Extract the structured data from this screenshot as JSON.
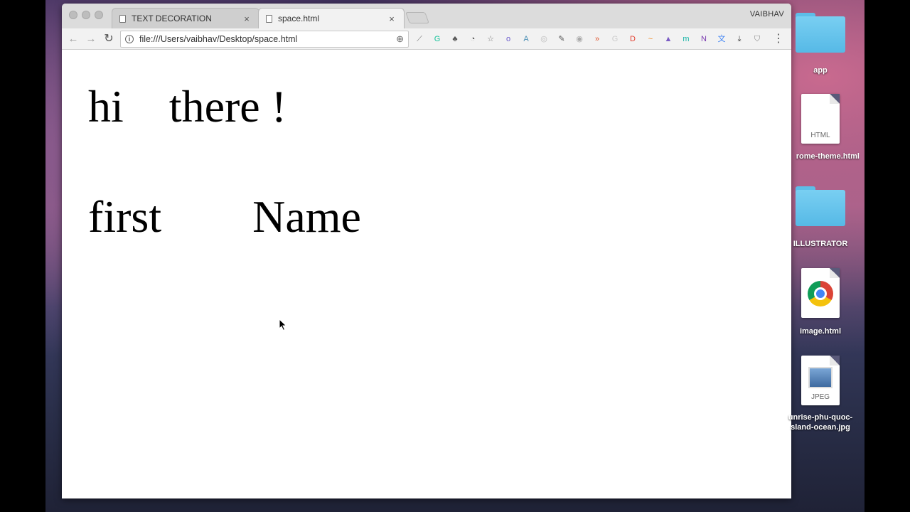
{
  "browser": {
    "tabs": [
      {
        "title": "TEXT DECORATION",
        "close": "×"
      },
      {
        "title": "space.html",
        "close": "×"
      }
    ],
    "profile_name": "VAIBHAV",
    "url": "file:///Users/vaibhav/Desktop/space.html",
    "nav": {
      "back": "←",
      "forward": "→",
      "reload": "↻"
    },
    "info_glyph": "i",
    "zoom_glyph": "⊕",
    "menu_glyph": "⋮",
    "extensions": [
      {
        "name": "extension-1-icon",
        "glyph": "⟋",
        "color": "#777777"
      },
      {
        "name": "grammarly-icon",
        "glyph": "G",
        "color": "#15c39a"
      },
      {
        "name": "evernote-icon",
        "glyph": "♣",
        "color": "#555555"
      },
      {
        "name": "speed-icon",
        "glyph": "◔",
        "color": "#555555"
      },
      {
        "name": "bookmark-star-icon",
        "glyph": "☆",
        "color": "#777777"
      },
      {
        "name": "extension-o-icon",
        "glyph": "o",
        "color": "#6a5acd"
      },
      {
        "name": "extension-a-icon",
        "glyph": "A",
        "color": "#4a8fb5"
      },
      {
        "name": "camera-icon",
        "glyph": "◎",
        "color": "#bbbbbb"
      },
      {
        "name": "eyedropper-icon",
        "glyph": "✎",
        "color": "#555555"
      },
      {
        "name": "extension-circle-icon",
        "glyph": "◉",
        "color": "#aaaaaa"
      },
      {
        "name": "arrow-forward-icon",
        "glyph": "»",
        "color": "#e0552e"
      },
      {
        "name": "extension-g-icon",
        "glyph": "G",
        "color": "#cccccc"
      },
      {
        "name": "extension-d-icon",
        "glyph": "D",
        "color": "#e33e2e"
      },
      {
        "name": "extension-wave-icon",
        "glyph": "~",
        "color": "#f08a24"
      },
      {
        "name": "chart-icon",
        "glyph": "▲",
        "color": "#7b5cc4"
      },
      {
        "name": "extension-m-icon",
        "glyph": "m",
        "color": "#17b5a7"
      },
      {
        "name": "onenote-icon",
        "glyph": "N",
        "color": "#7b3bb0"
      },
      {
        "name": "translate-icon",
        "glyph": "文",
        "color": "#4285f4"
      },
      {
        "name": "download-icon",
        "glyph": "⤓",
        "color": "#444444"
      },
      {
        "name": "shield-icon",
        "glyph": "⛉",
        "color": "#888888"
      }
    ]
  },
  "page": {
    "line1": "hi    there !",
    "line2": "first        Name"
  },
  "desktop": {
    "items": [
      {
        "label": "app",
        "kind": "folder"
      },
      {
        "label": "rome-theme.html",
        "kind": "file",
        "type_label": "HTML"
      },
      {
        "label": "ILLUSTRATOR",
        "kind": "folder"
      },
      {
        "label": "image.html",
        "kind": "chrome-file"
      },
      {
        "label": "unrise-phu-quoc-\nsland-ocean.jpg",
        "kind": "file",
        "type_label": "JPEG"
      }
    ]
  }
}
